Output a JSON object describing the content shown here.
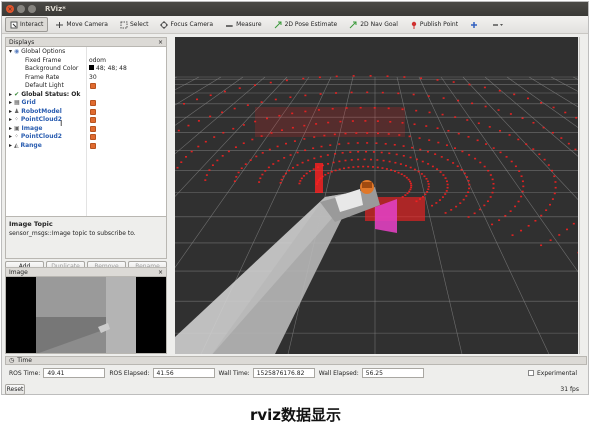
{
  "window": {
    "title": "RViz*"
  },
  "toolbar": {
    "interact": "Interact",
    "move_camera": "Move Camera",
    "select": "Select",
    "focus_camera": "Focus Camera",
    "measure": "Measure",
    "pose_estimate": "2D Pose Estimate",
    "nav_goal": "2D Nav Goal",
    "publish_point": "Publish Point"
  },
  "displays": {
    "header": "Displays",
    "global_options": "Global Options",
    "fixed_frame_label": "Fixed Frame",
    "fixed_frame_value": "odom",
    "bg_color_label": "Background Color",
    "bg_color_value": "48; 48; 48",
    "bg_color_hex": "#303030",
    "frame_rate_label": "Frame Rate",
    "frame_rate_value": "30",
    "default_light_label": "Default Light",
    "global_status": "Global Status: Ok",
    "items": [
      {
        "label": "Grid",
        "color": "#2a5db0"
      },
      {
        "label": "RobotModel",
        "color": "#2a5db0"
      },
      {
        "label": "PointCloud2",
        "color": "#2a5db0"
      },
      {
        "label": "Image",
        "color": "#2a5db0"
      },
      {
        "label": "PointCloud2",
        "color": "#2a5db0"
      },
      {
        "label": "Range",
        "color": "#2a5db0"
      }
    ]
  },
  "description": {
    "title": "Image Topic",
    "text": "sensor_msgs::Image topic to subscribe to."
  },
  "buttons": {
    "add": "Add",
    "duplicate": "Duplicate",
    "remove": "Remove",
    "rename": "Rename"
  },
  "image_panel": {
    "header": "Image"
  },
  "time": {
    "header": "Time",
    "ros_time_label": "ROS Time:",
    "ros_time": "49.41",
    "ros_elapsed_label": "ROS Elapsed:",
    "ros_elapsed": "41.56",
    "wall_time_label": "Wall Time:",
    "wall_time": "1525876176.82",
    "wall_elapsed_label": "Wall Elapsed:",
    "wall_elapsed": "56.25",
    "experimental_label": "Experimental"
  },
  "status": {
    "reset": "Reset",
    "fps": "31 fps"
  },
  "caption": "rviz数据显示",
  "colors": {
    "pointcloud": "#ff2020",
    "robot": "#e0782a",
    "range": "#e040c0"
  }
}
